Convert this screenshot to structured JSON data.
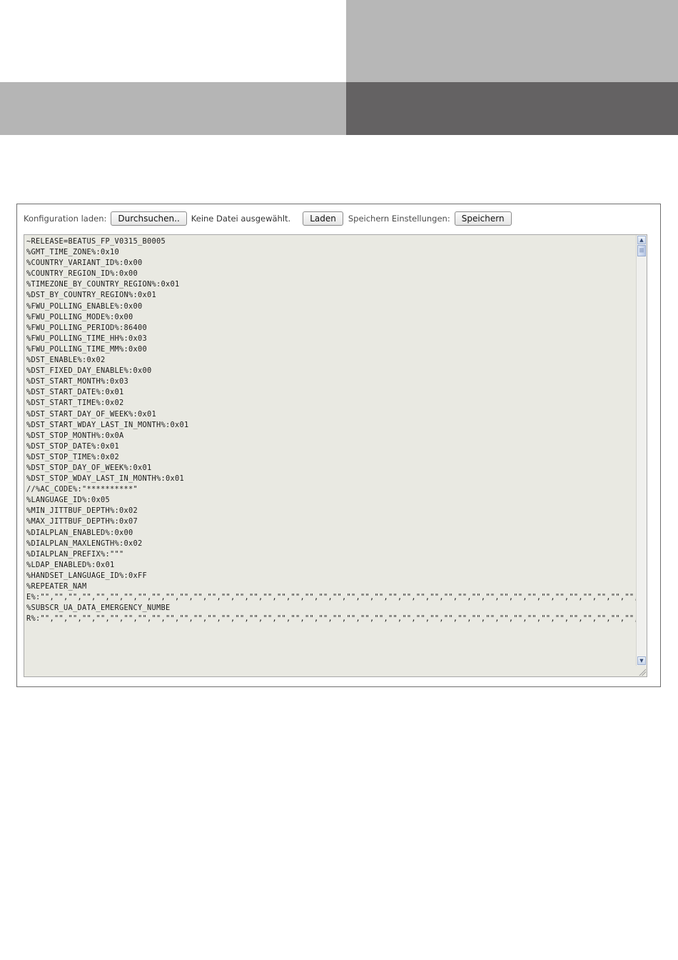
{
  "toolbar": {
    "load_config_label": "Konfiguration laden:",
    "browse_button": "Durchsuchen..",
    "no_file_text": "Keine Datei ausgewählt.",
    "load_button": "Laden",
    "save_settings_label": "Speichern Einstellungen:",
    "save_button": "Speichern"
  },
  "config_lines": [
    "~RELEASE=BEATUS_FP_V0315_B0005",
    "%GMT_TIME_ZONE%:0x10",
    "%COUNTRY_VARIANT_ID%:0x00",
    "%COUNTRY_REGION_ID%:0x00",
    "%TIMEZONE_BY_COUNTRY_REGION%:0x01",
    "%DST_BY_COUNTRY_REGION%:0x01",
    "%FWU_POLLING_ENABLE%:0x00",
    "%FWU_POLLING_MODE%:0x00",
    "%FWU_POLLING_PERIOD%:86400",
    "%FWU_POLLING_TIME_HH%:0x03",
    "%FWU_POLLING_TIME_MM%:0x00",
    "%DST_ENABLE%:0x02",
    "%DST_FIXED_DAY_ENABLE%:0x00",
    "%DST_START_MONTH%:0x03",
    "%DST_START_DATE%:0x01",
    "%DST_START_TIME%:0x02",
    "%DST_START_DAY_OF_WEEK%:0x01",
    "%DST_START_WDAY_LAST_IN_MONTH%:0x01",
    "%DST_STOP_MONTH%:0x0A",
    "%DST_STOP_DATE%:0x01",
    "%DST_STOP_TIME%:0x02",
    "%DST_STOP_DAY_OF_WEEK%:0x01",
    "%DST_STOP_WDAY_LAST_IN_MONTH%:0x01",
    "//%AC_CODE%:\"**********\"",
    "%LANGUAGE_ID%:0x05",
    "%MIN_JITTBUF_DEPTH%:0x02",
    "%MAX_JITTBUF_DEPTH%:0x07",
    "%DIALPLAN_ENABLED%:0x00",
    "%DIALPLAN_MAXLENGTH%:0x02",
    "%DIALPLAN_PREFIX%:\"\"\"",
    "%LDAP_ENABLED%:0x01",
    "%HANDSET_LANGUAGE_ID%:0xFF",
    "%REPEATER_NAME%:\"\",\"\",\"\",\"\",\"\",\"\",\"\",\"\",\"\",\"\",\"\",\"\",\"\",\"\",\"\",\"\",\"\",\"\",\"\",\"\",\"\",\"\",\"\",\"\",\"\",\"\",\"\",\"\",\"\",\"\",\"\",\"\",\"\",\"\",\"\",\"\",\"\",\"\",\"\",\"\",\"\",\"\",\"\",\"\",\"\",\"\",\"\",\"\",\"\",\"\",\"\",\"\",\"\",\"\",\"\",\"\",\"\",\"\",\"\",\"\",\"\",\"\",\"\",\"\",\"\",\"\",\"\",\"\",\"\",\"\",\"\",\"\",\"\",\"\",\"\",\"\",\"\",\"\",\"\",\"\",\"\",\"\",\"\",\"\",\"\",\"\",\"\",\"\",\"\",\"\",\"\",\"\",\"\",\"\",\"\",\"\",\"\",\"\",\"\",\"\",\"\",\"\",\"\",\"\",\"\",\"\",\"\"",
    "%SUBSCR_UA_DATA_EMERGENCY_NUMBER%:\"\",\"\",\"\",\"\",\"\",\"\",\"\",\"\",\"\",\"\",\"\",\"\",\"\",\"\",\"\",\"\",\"\",\"\",\"\",\"\",\"\",\"\",\"\",\"\",\"\",\"\",\"\",\"\",\"\",\"\",\"\",\"\",\"\",\"\",\"\",\"\",\"\",\"\",\"\",\"\",\"\",\"\",\"\",\"\",\"\",\"\",\"\",\"\",\"\",\"\",\"\",\"\",\"\",\"\",\"\",\"\",\"\",\"\",\"\",\"\",\"\",\"\",\"\",\"\",\"\",\"\",\"\",\"\",\"\",\"\",\"\",\"\",\"\",\"\",\"\",\"\",\"\",\"\",\"\",\"\",\"\",\"\",\"\",\"\",\"\",\"\",\"\",\"\",\"\",\"\",\"\",\"\",\"\",\"\",\"\",\"\",\"\",\"\",\"\",\"\",\"\",\"\",\"\",\"\",\"\",\"\",\"\",\"\",\"\",\"\",\"\",\"\",\"\",\"\",\"\",\"\",\"\",\"\",\"\",\"\",\"\",\"\",\"\",\"\",\"\",\"\",\"\",\"\",\"\",\"\",\"\",\"\",\"\",\"\",\"\",\"\",\"\",\"\",\"\",\"\",\"\",\"\",\"\",\"\",\"\",\"\",\"\",\"\",\"\",\"\",\"\",\"\",\"\",\"\",\"\",\"\",\"\",\"\",\"\",\"\",\"\",\"\",\"\",\"\",\"\",\"\",\"\",\"\",\"\",\"\",\"\",\"\",\"\",\"\",\"\",\"\",\"\",\"\",\"\",\"\",\"\",\"\",\"\",\"\",\"\",\"\",\"\",\"\",\"\",\"\",\"\",\"\",\"\",\"\",\"\",\"\",\"\",\"\",\"\",\"\",\"\",\"\",\"\",\"\",\"\",\"\",\"\",\"\",\"\",\"\",\"\",\"\",\"\",\"\",\"\",\"\",\"\",\"\",\"\",\"\",\"\",\"\",\"\",\"\",\"\",\"\",\"\",\"\",\"\",\"\",\"\",\"\",\"\",\"\",\"\",\"\",\"\",\"\",\"\",\"\",\"\",\"\",\"\",\"\",\"\",\"\",\"\",\"\",\"\",\"\",\"\",\"\",\"\",\"\",\"\",\"\",\"\",\"\",\"\",\"\",\"\",\"\",\"\",\"\",\"\",\"\",\"\",\"\",\"\",\"\",\"\",\"\",\"\",\"\",\"\",\"\",\"\",\"\",\"\",\"\",\"\",\"\",\"\",\"\",\"\",\"\",\"\",\"\",\"\",\"\",\"\",\"\",\"\",\"\",\"\",\"\",\"\",\"\",\"\",\"\",\"\",\"\",\"\",\"\",\"\",\"\",\"\",\"\",\"\",\"\",\"\",\"\",\"\",\"\",\"\",\"\",\"\",\"\",\"\",\"\",\"\",\"\",\"\",\"\",\"\",\"\",\"\",\"\",\"\",\"\",\"\",\"\",\"\",\"\",\"\",\"\",\"\",\"\",\"\",\"\",\"\",\"\",\"\",\"\",\"\",\"\",\"\",\"\",\"\",\"\",\"\",\"\",\"\",\"\",\"\",\"\",\"\",\"\",\"\",\"\",\"\",\"\",\"\",\"\",\"\",\"\",\"\",\"\",\"\",\"\",\"\",\"\",\"\",\"\",\"\",\"\",\"\",\"\",\"\",\"\",\"\",\"\",\"\",\"\",\"\",\"\",\"\",\"\",\"\",\"\",\"\",\"\",\"\",\"\",\"\",\"\",\"\",\"\",\"\",\"\",\"\",\"\",\"\",\"\",\"\",\"\",\"\",\"\",\"\",\"\",\"\",\"\",\"\",\"\",\"\",\"\",\"\",\"\",\"\",\"\",\"\",\"\",\"\",\"\",\"\",\"\",\"\",\"\",\"\",\"\",\"\",\"\",\"\",\"\",\"\",\"\",\"\",\"\",\"\",\"\",\"\",\"\",\"\",\"\",\"\",\"\",\"\",\"\",\"\",\"\",\"\",\"\",\"\",\"\",\"\",\"\",\"\",\"\",\"\",\"\",\"\",\"\",\"\",\"\",\"\",\"\",\"\",\"\""
  ],
  "colors": {
    "header_light": "#b7b7b7",
    "header_dark": "#646263",
    "editor_bg": "#e9e9e2"
  },
  "icons": {
    "scroll_up": "scroll-up-arrow-icon",
    "scroll_down": "scroll-down-arrow-icon",
    "resize": "resize-grip-icon"
  }
}
